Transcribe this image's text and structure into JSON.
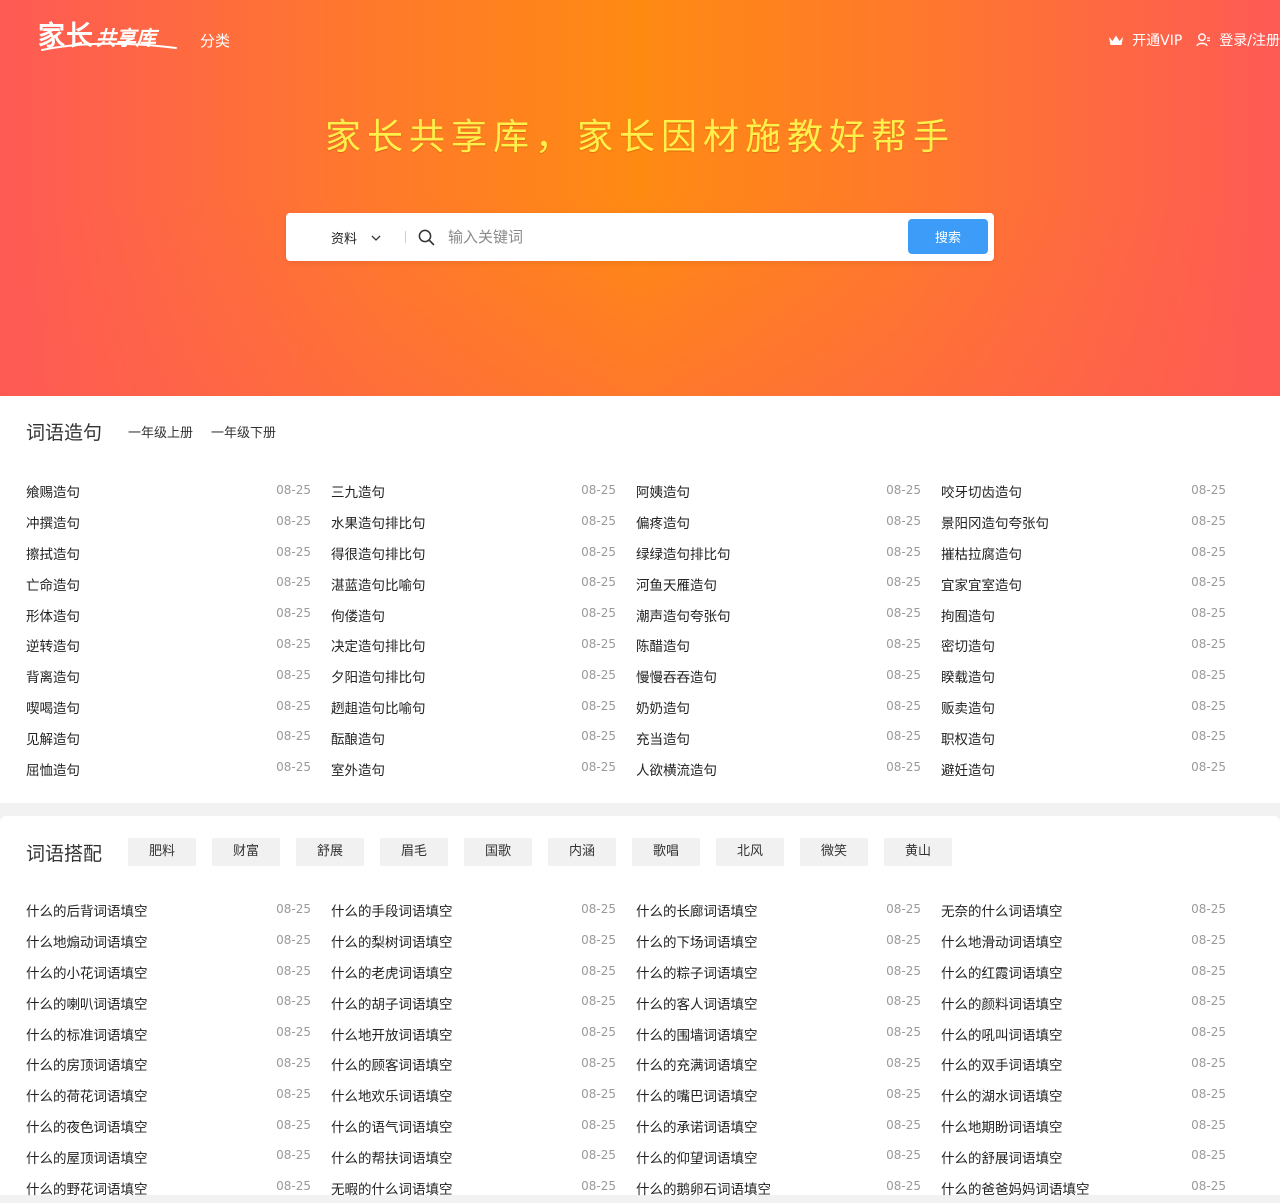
{
  "brand": {
    "logo_big": "家长",
    "logo_small": "共享库"
  },
  "nav": {
    "category": "分类",
    "vip": "开通VIP",
    "login": "登录/注册"
  },
  "hero": {
    "slogan": "家长共享库，家长因材施教好帮手"
  },
  "search": {
    "type": "资料",
    "placeholder": "输入关键词",
    "button": "搜索"
  },
  "section1": {
    "title": "词语造句",
    "tabs": [
      "一年级上册",
      "一年级下册"
    ],
    "items": [
      {
        "t": "飨赐造句",
        "d": "08-25"
      },
      {
        "t": "三九造句",
        "d": "08-25"
      },
      {
        "t": "阿姨造句",
        "d": "08-25"
      },
      {
        "t": "咬牙切齿造句",
        "d": "08-25"
      },
      {
        "t": "冲撰造句",
        "d": "08-25"
      },
      {
        "t": "水果造句排比句",
        "d": "08-25"
      },
      {
        "t": "偏疼造句",
        "d": "08-25"
      },
      {
        "t": "景阳冈造句夸张句",
        "d": "08-25"
      },
      {
        "t": "擦拭造句",
        "d": "08-25"
      },
      {
        "t": "得很造句排比句",
        "d": "08-25"
      },
      {
        "t": "绿绿造句排比句",
        "d": "08-25"
      },
      {
        "t": "摧枯拉腐造句",
        "d": "08-25"
      },
      {
        "t": "亡命造句",
        "d": "08-25"
      },
      {
        "t": "湛蓝造句比喻句",
        "d": "08-25"
      },
      {
        "t": "河鱼天雁造句",
        "d": "08-25"
      },
      {
        "t": "宜家宜室造句",
        "d": "08-25"
      },
      {
        "t": "形体造句",
        "d": "08-25"
      },
      {
        "t": "佝偻造句",
        "d": "08-25"
      },
      {
        "t": "潮声造句夸张句",
        "d": "08-25"
      },
      {
        "t": "拘囿造句",
        "d": "08-25"
      },
      {
        "t": "逆转造句",
        "d": "08-25"
      },
      {
        "t": "决定造句排比句",
        "d": "08-25"
      },
      {
        "t": "陈醋造句",
        "d": "08-25"
      },
      {
        "t": "密切造句",
        "d": "08-25"
      },
      {
        "t": "背离造句",
        "d": "08-25"
      },
      {
        "t": "夕阳造句排比句",
        "d": "08-25"
      },
      {
        "t": "慢慢吞吞造句",
        "d": "08-25"
      },
      {
        "t": "睽载造句",
        "d": "08-25"
      },
      {
        "t": "喫喝造句",
        "d": "08-25"
      },
      {
        "t": "趔趄造句比喻句",
        "d": "08-25"
      },
      {
        "t": "奶奶造句",
        "d": "08-25"
      },
      {
        "t": "贩卖造句",
        "d": "08-25"
      },
      {
        "t": "见解造句",
        "d": "08-25"
      },
      {
        "t": "酝酿造句",
        "d": "08-25"
      },
      {
        "t": "充当造句",
        "d": "08-25"
      },
      {
        "t": "职权造句",
        "d": "08-25"
      },
      {
        "t": "屈恤造句",
        "d": "08-25"
      },
      {
        "t": "室外造句",
        "d": "08-25"
      },
      {
        "t": "人欲横流造句",
        "d": "08-25"
      },
      {
        "t": "避妊造句",
        "d": "08-25"
      }
    ]
  },
  "section2": {
    "title": "词语搭配",
    "tabs": [
      "肥料",
      "财富",
      "舒展",
      "眉毛",
      "国歌",
      "内涵",
      "歌唱",
      "北风",
      "微笑",
      "黄山"
    ],
    "items": [
      {
        "t": "什么的后背词语填空",
        "d": "08-25"
      },
      {
        "t": "什么的手段词语填空",
        "d": "08-25"
      },
      {
        "t": "什么的长廊词语填空",
        "d": "08-25"
      },
      {
        "t": "无奈的什么词语填空",
        "d": "08-25"
      },
      {
        "t": "什么地煽动词语填空",
        "d": "08-25"
      },
      {
        "t": "什么的梨树词语填空",
        "d": "08-25"
      },
      {
        "t": "什么的下场词语填空",
        "d": "08-25"
      },
      {
        "t": "什么地滑动词语填空",
        "d": "08-25"
      },
      {
        "t": "什么的小花词语填空",
        "d": "08-25"
      },
      {
        "t": "什么的老虎词语填空",
        "d": "08-25"
      },
      {
        "t": "什么的粽子词语填空",
        "d": "08-25"
      },
      {
        "t": "什么的红霞词语填空",
        "d": "08-25"
      },
      {
        "t": "什么的喇叭词语填空",
        "d": "08-25"
      },
      {
        "t": "什么的胡子词语填空",
        "d": "08-25"
      },
      {
        "t": "什么的客人词语填空",
        "d": "08-25"
      },
      {
        "t": "什么的颜料词语填空",
        "d": "08-25"
      },
      {
        "t": "什么的标准词语填空",
        "d": "08-25"
      },
      {
        "t": "什么地开放词语填空",
        "d": "08-25"
      },
      {
        "t": "什么的围墙词语填空",
        "d": "08-25"
      },
      {
        "t": "什么的吼叫词语填空",
        "d": "08-25"
      },
      {
        "t": "什么的房顶词语填空",
        "d": "08-25"
      },
      {
        "t": "什么的顾客词语填空",
        "d": "08-25"
      },
      {
        "t": "什么的充满词语填空",
        "d": "08-25"
      },
      {
        "t": "什么的双手词语填空",
        "d": "08-25"
      },
      {
        "t": "什么的荷花词语填空",
        "d": "08-25"
      },
      {
        "t": "什么地欢乐词语填空",
        "d": "08-25"
      },
      {
        "t": "什么的嘴巴词语填空",
        "d": "08-25"
      },
      {
        "t": "什么的湖水词语填空",
        "d": "08-25"
      },
      {
        "t": "什么的夜色词语填空",
        "d": "08-25"
      },
      {
        "t": "什么的语气词语填空",
        "d": "08-25"
      },
      {
        "t": "什么的承诺词语填空",
        "d": "08-25"
      },
      {
        "t": "什么地期盼词语填空",
        "d": "08-25"
      },
      {
        "t": "什么的屋顶词语填空",
        "d": "08-25"
      },
      {
        "t": "什么的帮扶词语填空",
        "d": "08-25"
      },
      {
        "t": "什么的仰望词语填空",
        "d": "08-25"
      },
      {
        "t": "什么的舒展词语填空",
        "d": "08-25"
      },
      {
        "t": "什么的野花词语填空",
        "d": "08-25"
      },
      {
        "t": "无暇的什么词语填空",
        "d": "08-25"
      },
      {
        "t": "什么的鹅卵石词语填空",
        "d": "08-25"
      },
      {
        "t": "什么的爸爸妈妈词语填空",
        "d": "08-25"
      }
    ]
  }
}
